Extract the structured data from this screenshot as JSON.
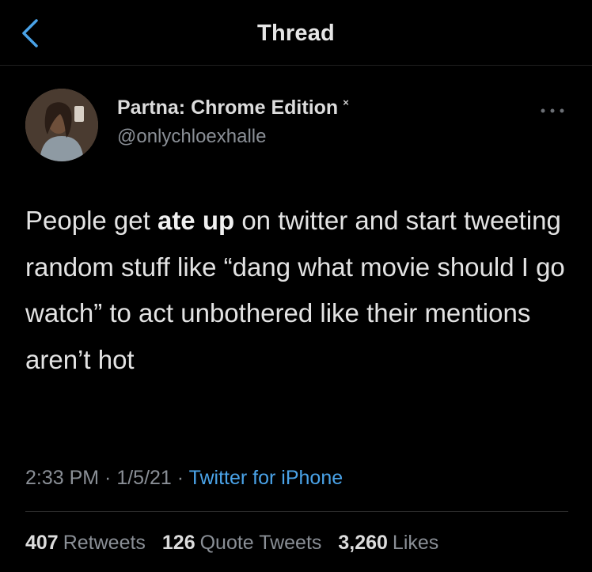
{
  "header": {
    "title": "Thread",
    "back_icon": "chevron-left-icon"
  },
  "author": {
    "name": "Partna: Chrome Edition",
    "badge": "×",
    "handle": "@onlychloexhalle",
    "avatar": "profile photo"
  },
  "tweet": {
    "text_before_bold": "People get ",
    "text_bold": "ate up",
    "text_after_bold": " on twitter and start tweeting random stuff like “dang what movie should I go watch” to act unbothered like their mentions aren’t hot"
  },
  "meta": {
    "time": "2:33 PM",
    "separator1": " · ",
    "date": "1/5/21",
    "separator2": " · ",
    "source": "Twitter for iPhone"
  },
  "stats": {
    "retweets_count": "407",
    "retweets_label": "Retweets",
    "quotes_count": "126",
    "quotes_label": "Quote Tweets",
    "likes_count": "3,260",
    "likes_label": "Likes"
  },
  "colors": {
    "background": "#000000",
    "link": "#4aa3e8",
    "muted": "#8a8f96"
  }
}
